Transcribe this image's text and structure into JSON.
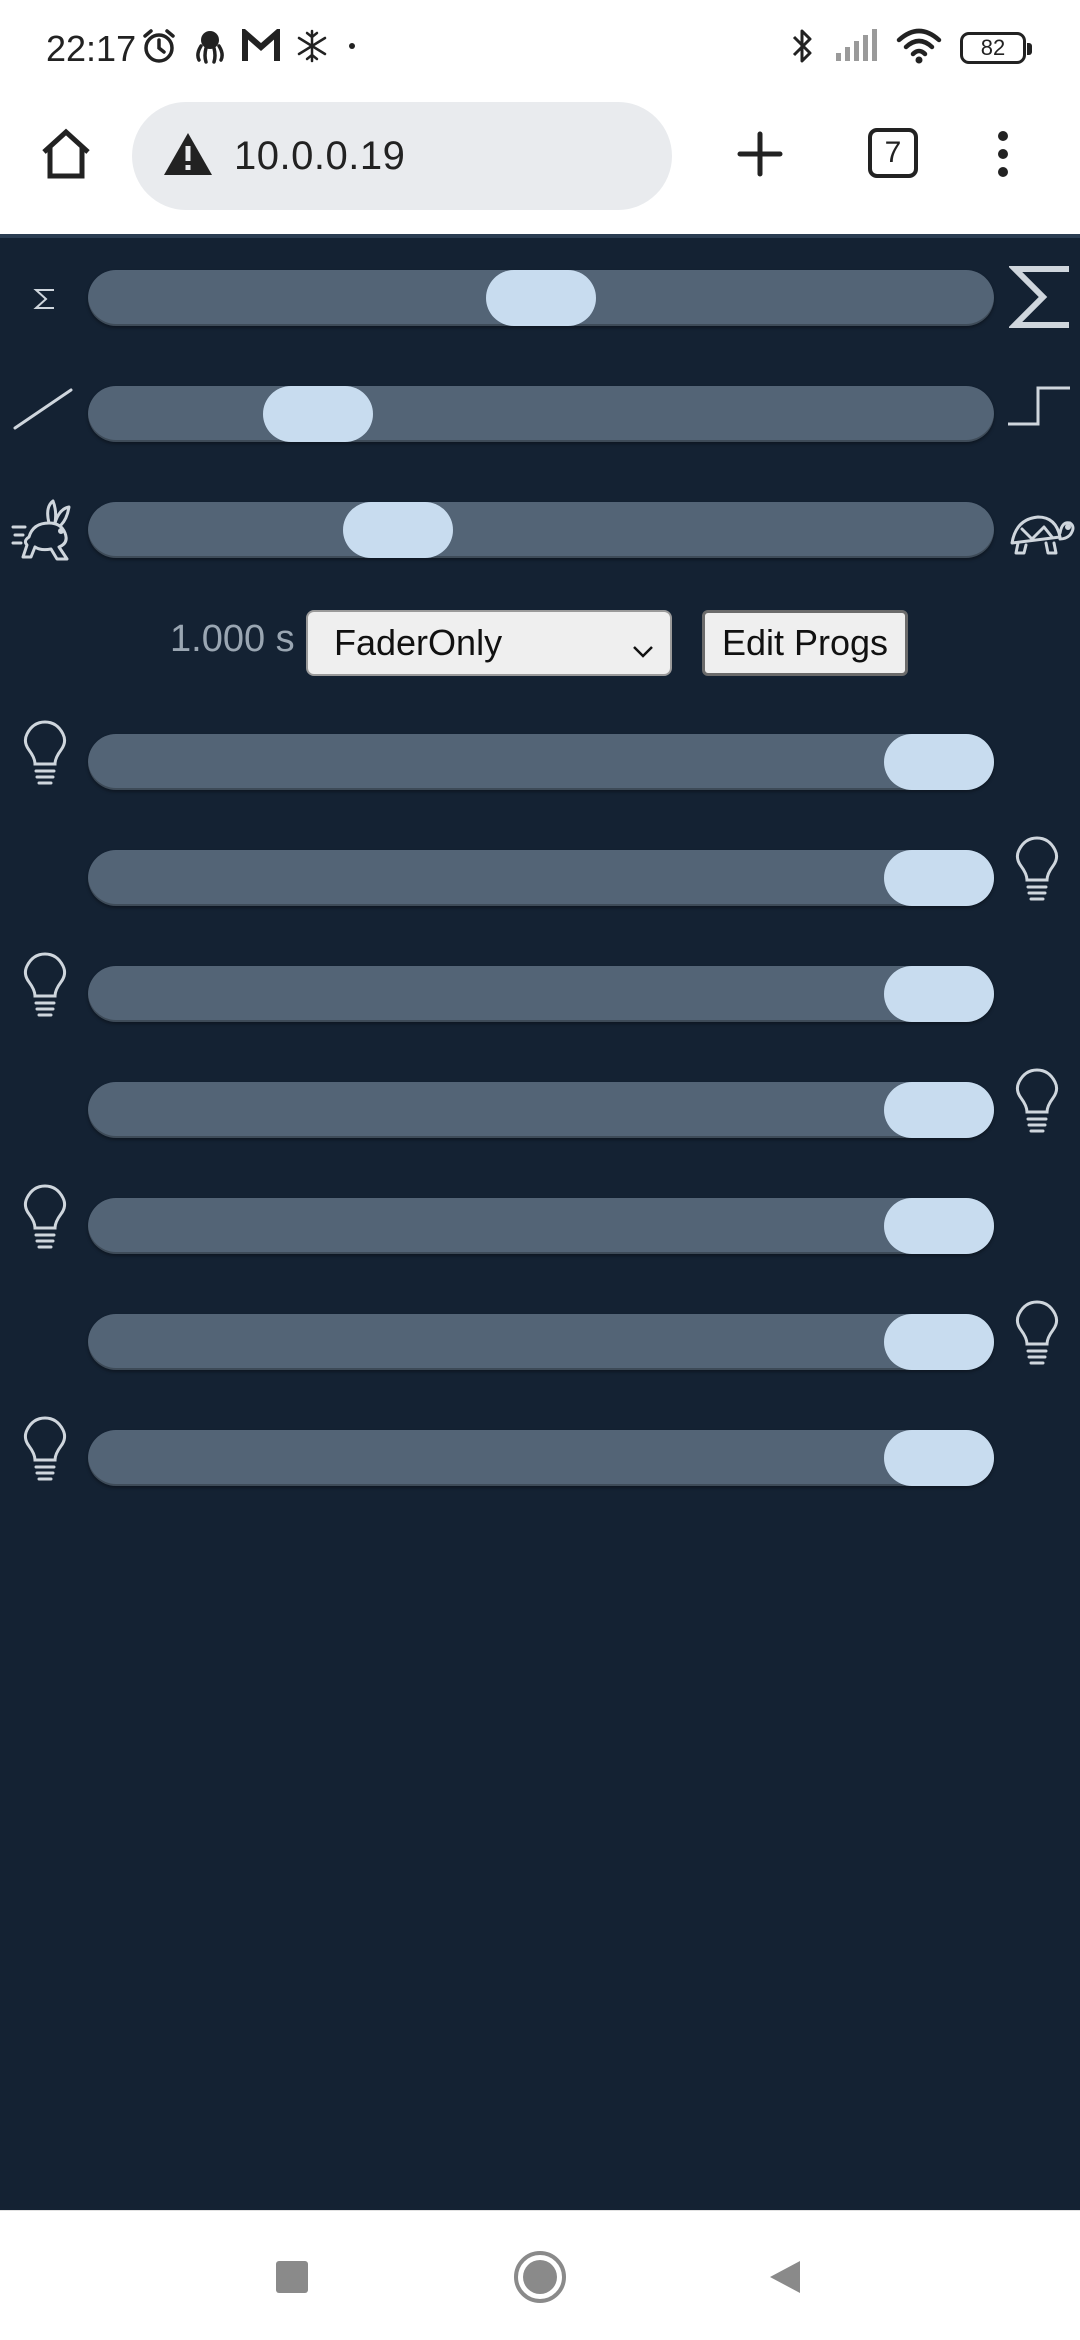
{
  "status_bar": {
    "time": "22:17",
    "battery": "82",
    "left_icons": [
      "alarm-icon",
      "octopus-icon",
      "gmail-icon",
      "snowflake-icon",
      "dot-icon"
    ],
    "right_icons": [
      "bluetooth-icon",
      "signal-icon",
      "wifi-icon",
      "battery-icon"
    ]
  },
  "browser": {
    "url": "10.0.0.19",
    "tab_count": "7",
    "icons": [
      "home-icon",
      "warning-icon",
      "plus-icon",
      "tabs-icon",
      "more-vert-icon"
    ]
  },
  "controls": {
    "duration_label": "1.000 s",
    "program_select": {
      "selected": "FaderOnly"
    },
    "edit_button_label": "Edit Progs"
  },
  "sliders": [
    {
      "id": "master",
      "left_icon": "sigma-icon",
      "right_icon": "sigma-large-icon",
      "value": 0.5
    },
    {
      "id": "curve",
      "left_icon": "ramp-icon",
      "right_icon": "step-icon",
      "value": 0.22
    },
    {
      "id": "speed",
      "left_icon": "rabbit-icon",
      "right_icon": "turtle-icon",
      "value": 0.32
    },
    {
      "id": "channel-1",
      "icon": "bulb-icon",
      "icon_side": "left",
      "value": 1.0
    },
    {
      "id": "channel-2",
      "icon": "bulb-icon",
      "icon_side": "right",
      "value": 1.0
    },
    {
      "id": "channel-3",
      "icon": "bulb-icon",
      "icon_side": "left",
      "value": 1.0
    },
    {
      "id": "channel-4",
      "icon": "bulb-icon",
      "icon_side": "right",
      "value": 1.0
    },
    {
      "id": "channel-5",
      "icon": "bulb-icon",
      "icon_side": "left",
      "value": 1.0
    },
    {
      "id": "channel-6",
      "icon": "bulb-icon",
      "icon_side": "right",
      "value": 1.0
    },
    {
      "id": "channel-7",
      "icon": "bulb-icon",
      "icon_side": "left",
      "value": 1.0
    }
  ],
  "colors": {
    "background": "#142233",
    "slider_track": "#536476",
    "slider_thumb": "#c8dcef",
    "icon": "#cfd6dd"
  },
  "nav_bar": {
    "icons": [
      "recents-icon",
      "home-circle-icon",
      "back-icon"
    ]
  }
}
